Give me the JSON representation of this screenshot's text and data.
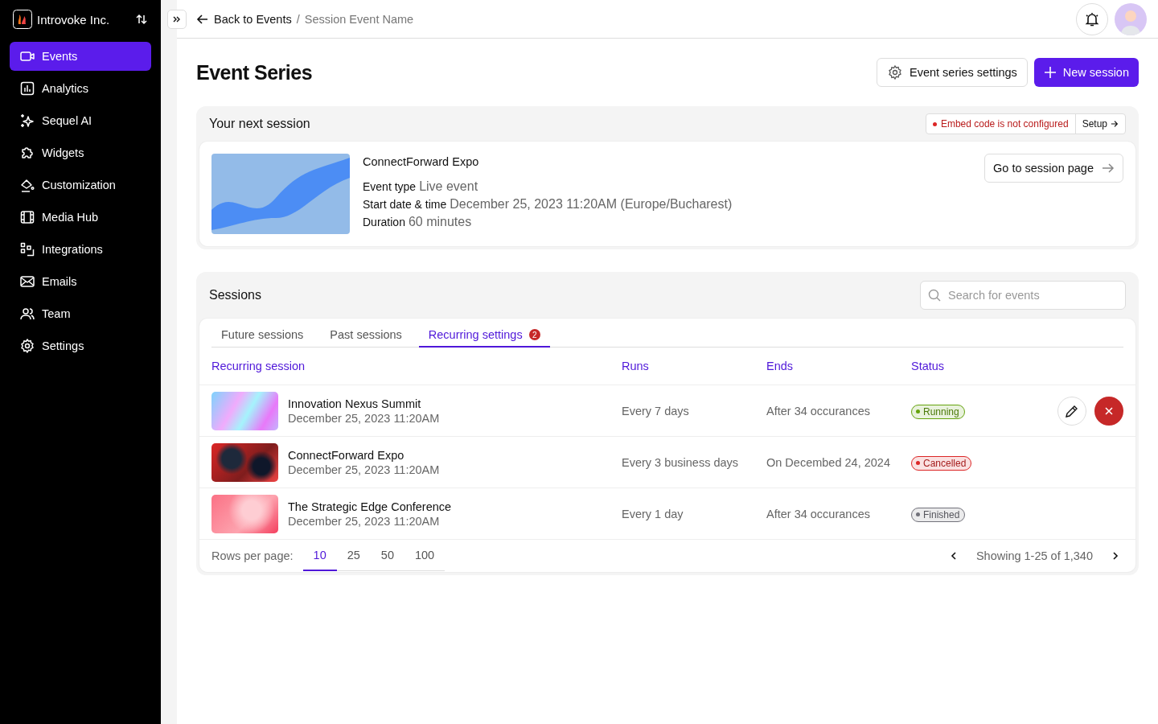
{
  "sidebar": {
    "org": "Introvoke Inc.",
    "items": [
      {
        "label": "Events",
        "selected": true
      },
      {
        "label": "Analytics",
        "selected": false
      },
      {
        "label": "Sequel AI",
        "selected": false
      },
      {
        "label": "Widgets",
        "selected": false
      },
      {
        "label": "Customization",
        "selected": false
      },
      {
        "label": "Media Hub",
        "selected": false
      },
      {
        "label": "Integrations",
        "selected": false
      },
      {
        "label": "Emails",
        "selected": false
      },
      {
        "label": "Team",
        "selected": false
      },
      {
        "label": "Settings",
        "selected": false
      }
    ]
  },
  "breadcrumb": {
    "back": "Back to Events",
    "separator": "/",
    "current": "Session Event Name"
  },
  "page": {
    "title": "Event Series",
    "settings_button": "Event series settings",
    "new_button": "New session"
  },
  "next_session": {
    "heading": "Your next session",
    "warning": "Embed code is not configured",
    "setup": "Setup",
    "name": "ConnectForward Expo",
    "go_button": "Go to session page",
    "details": [
      {
        "label": "Event type",
        "value": "Live event"
      },
      {
        "label": "Start date & time",
        "value": "December 25, 2023 11:20AM (Europe/Bucharest)"
      },
      {
        "label": "Duration",
        "value": "60 minutes"
      }
    ]
  },
  "sessions": {
    "heading": "Sessions",
    "search": {
      "placeholder": "Search for events"
    },
    "tabs": [
      {
        "label": "Future sessions",
        "selected": false
      },
      {
        "label": "Past sessions",
        "selected": false
      },
      {
        "label": "Recurring settings",
        "selected": true,
        "badge": "2"
      }
    ],
    "columns": [
      "Recurring session",
      "Runs",
      "Ends",
      "Status"
    ],
    "rows": [
      {
        "name": "Innovation Nexus Summit",
        "date": "December 25, 2023 11:20AM",
        "runs": "Every 7 days",
        "ends": "After 34 occurances",
        "status": {
          "label": "Running",
          "color": "#65a30d"
        },
        "show_actions": true
      },
      {
        "name": "ConnectForward Expo",
        "date": "December 25, 2023 11:20AM",
        "runs": "Every 3 business days",
        "ends": "On Decembed 24, 2024",
        "status": {
          "label": "Cancelled",
          "color": "#dc2626"
        },
        "show_actions": false
      },
      {
        "name": "The Strategic Edge Conference",
        "date": "December 25, 2023 11:20AM",
        "runs": "Every 1 day",
        "ends": "After 34 occurances",
        "status": {
          "label": "Finished",
          "color": "#71717a"
        },
        "show_actions": false
      }
    ],
    "rows_per_page_label": "Rows per page:",
    "page_sizes": [
      {
        "label": "10",
        "selected": true
      },
      {
        "label": "25",
        "selected": false
      },
      {
        "label": "50",
        "selected": false
      },
      {
        "label": "100",
        "selected": false
      }
    ],
    "showing": "Showing 1-25 of 1,340"
  }
}
